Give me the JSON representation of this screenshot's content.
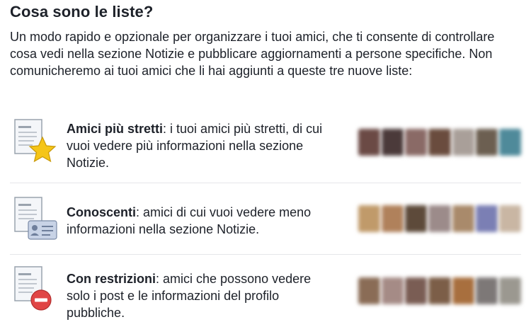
{
  "header": {
    "title": "Cosa sono le liste?"
  },
  "intro": {
    "text": "Un modo rapido e opzionale per organizzare i tuoi amici, che ti consente di controllare cosa vedi nella sezione Notizie e pubblicare aggiornamenti a persone specifiche. Non comunicheremo ai tuoi amici che li hai aggiunti a queste tre nuove liste:"
  },
  "lists": [
    {
      "name": "Amici più stretti",
      "description": ": i tuoi amici più stretti, di cui vuoi vedere più informazioni nella sezione Notizie.",
      "icon": "close-friends-star-icon"
    },
    {
      "name": "Conoscenti",
      "description": ": amici di cui vuoi vedere meno informazioni nella sezione Notizie.",
      "icon": "acquaintances-card-icon"
    },
    {
      "name": "Con restrizioni",
      "description": ": amici che possono vedere solo i post e le informazioni del profilo pubbliche.",
      "icon": "restricted-minus-icon"
    }
  ],
  "colors": {
    "star": "#f5c518",
    "restricted": "#e04545",
    "card": "#c8d3e6",
    "divider": "#e5e6e9"
  }
}
